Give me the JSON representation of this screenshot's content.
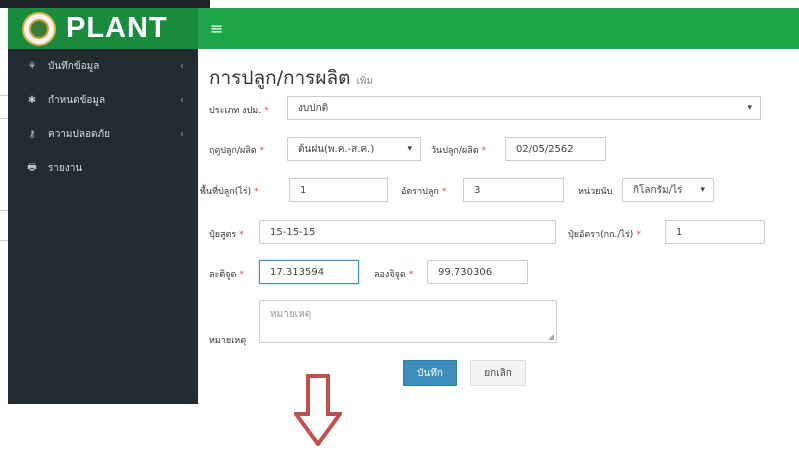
{
  "header": {
    "brand": "PLANT",
    "menu_icon": "≡"
  },
  "sidebar": {
    "items": [
      {
        "icon": "leaf-icon",
        "glyph": "⚘",
        "label": "บันทึกข้อมูล"
      },
      {
        "icon": "gear-icon",
        "glyph": "✱",
        "label": "กำหนดข้อมูล"
      },
      {
        "icon": "key-icon",
        "glyph": "⚷",
        "label": "ความปลอดภัย"
      },
      {
        "icon": "print-icon",
        "glyph": "🖶",
        "label": "รายงาน"
      }
    ],
    "chevron": "‹"
  },
  "main": {
    "title": "การปลูก/การผลิต",
    "subtitle": "เพิ่ม",
    "form": {
      "type_label": "ประเภท งปม.",
      "type_value": "งบปกติ",
      "season_label": "ฤดูปลูก/ผลิต",
      "season_value": "ต้นฝน(พ.ค.-ส.ค.)",
      "date_label": "วันปลูก/ผลิต",
      "date_value": "02/05/2562",
      "area_label": "พื้นที่ปลูก(ไร่)",
      "area_value": "1",
      "rate_label": "อัตราปลูก",
      "rate_value": "3",
      "unit_label": "หน่วยนับ",
      "unit_value": "กิโลกรัม/ไร่",
      "fert_label": "ปุ๋ยสูตร",
      "fert_value": "15-15-15",
      "fert_rate_label": "ปุ๋ยอัตรา(กก./ไร่)",
      "fert_rate_value": "1",
      "lat_label": "ละติจูด",
      "lat_value": "17.313594",
      "lon_label": "ลองจิจูด",
      "lon_value": "99.730306",
      "note_label": "หมายเหตุ",
      "note_placeholder": "หมายเหตุ",
      "required_mark": "*"
    },
    "buttons": {
      "save": "บันทึก",
      "cancel": "ยกเลิก"
    }
  },
  "colors": {
    "brand_green": "#1a8a3c",
    "navbar_green": "#1fa64a",
    "sidebar_bg": "#222d32",
    "primary_button": "#3c8dbc",
    "arrow": "#c0504d"
  }
}
